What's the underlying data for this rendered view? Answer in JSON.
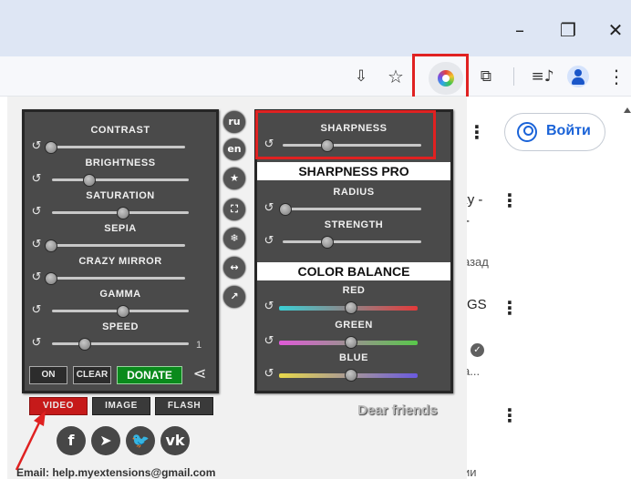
{
  "window": {
    "minimize_glyph": "–",
    "maximize_glyph": "❐",
    "close_glyph": "✕"
  },
  "toolbar": {
    "icons": [
      "install-app-icon",
      "bookmark-star-icon",
      "color-extension-icon",
      "extensions-puzzle-icon",
      "media-control-icon",
      "profile-avatar-icon",
      "more-menu-icon"
    ],
    "install_glyph": "⇩",
    "star_glyph": "☆",
    "puzzle_glyph": "⧉",
    "media_glyph": "≡♪",
    "kebab_glyph": "⋮"
  },
  "page": {
    "login_label": "Войти",
    "snippet_1": "ку -",
    "snippet_1b": "-",
    "snippet_2": "азад",
    "snippet_3": "GS",
    "snippet_4": "а...",
    "snippet_5": "ии",
    "kebab_glyph": "⋮",
    "check_glyph": "✓"
  },
  "popup": {
    "left_sliders": [
      {
        "label": "CONTRAST",
        "value": 0
      },
      {
        "label": "BRIGHTNESS",
        "value": 0.25
      },
      {
        "label": "SATURATION",
        "value": 0.5
      },
      {
        "label": "SEPIA",
        "value": 0
      },
      {
        "label": "CRAZY MIRROR",
        "value": 0
      },
      {
        "label": "GAMMA",
        "value": 0.5
      },
      {
        "label": "SPEED",
        "value": 0.22
      }
    ],
    "speed_value": "1",
    "reset_glyph": "↺",
    "buttons": {
      "on": "ON",
      "clear": "CLEAR",
      "donate": "DONATE"
    },
    "share_glyph": "⋖",
    "side_icons": [
      {
        "name": "lang-ru-icon",
        "glyph": "ru"
      },
      {
        "name": "lang-en-icon",
        "glyph": "en"
      },
      {
        "name": "favorite-star-icon",
        "glyph": "★"
      },
      {
        "name": "fullscreen-icon",
        "glyph": "⛶"
      },
      {
        "name": "settings-gear-icon",
        "glyph": "❄"
      },
      {
        "name": "resize-arrows-icon",
        "glyph": "↔"
      },
      {
        "name": "open-external-icon",
        "glyph": "↗"
      }
    ],
    "sharpness": {
      "label": "SHARPNESS",
      "value": 0.3
    },
    "sharpness_pro": {
      "header": "SHARPNESS PRO",
      "sliders": [
        {
          "label": "RADIUS",
          "value": 0
        },
        {
          "label": "STRENGTH",
          "value": 0.3
        }
      ]
    },
    "color_balance": {
      "header": "COLOR BALANCE",
      "sliders": [
        {
          "label": "RED",
          "value": 0.5
        },
        {
          "label": "GREEN",
          "value": 0.5
        },
        {
          "label": "BLUE",
          "value": 0.5
        }
      ]
    },
    "tabs": [
      "VIDEO",
      "IMAGE",
      "FLASH"
    ],
    "social": [
      {
        "name": "facebook-icon",
        "glyph": "f"
      },
      {
        "name": "telegram-icon",
        "glyph": "➤"
      },
      {
        "name": "twitter-icon",
        "glyph": "🐦"
      },
      {
        "name": "vk-icon",
        "glyph": "vk"
      }
    ],
    "dear_text": "Dear friends",
    "email": "Email:  help.myextensions@gmail.com"
  },
  "colors": {
    "accent_red": "#e02121",
    "donate_green": "#0a8a1c",
    "panel_bg": "#4a4a4a",
    "link_blue": "#1a63d8"
  }
}
